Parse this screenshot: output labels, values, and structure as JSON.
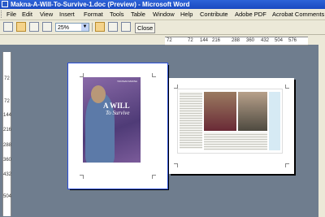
{
  "window": {
    "title": "Makna-A-Will-To-Survive-1.doc (Preview) - Microsoft Word"
  },
  "menu": [
    "File",
    "Edit",
    "View",
    "Insert",
    "Format",
    "Tools",
    "Table",
    "Window",
    "Help",
    "Contribute",
    "Adobe PDF",
    "Acrobat Comments"
  ],
  "toolbar": {
    "zoom_value": "25%",
    "close_label": "Close"
  },
  "ruler": {
    "horizontal_ticks": [
      "72",
      "72",
      "144",
      "216",
      "288",
      "360",
      "432",
      "504",
      "576"
    ],
    "vertical_ticks": [
      "72",
      "72",
      "144",
      "216",
      "288",
      "360",
      "432",
      "504"
    ]
  },
  "cover": {
    "brand": "YAYASAN MAKNA",
    "title_line1": "A WILL",
    "title_line2": "To Survive"
  },
  "colors": {
    "titlebar": "#1a49c0",
    "workspace": "#6f7d8e",
    "cover_purple": "#5a4380"
  }
}
